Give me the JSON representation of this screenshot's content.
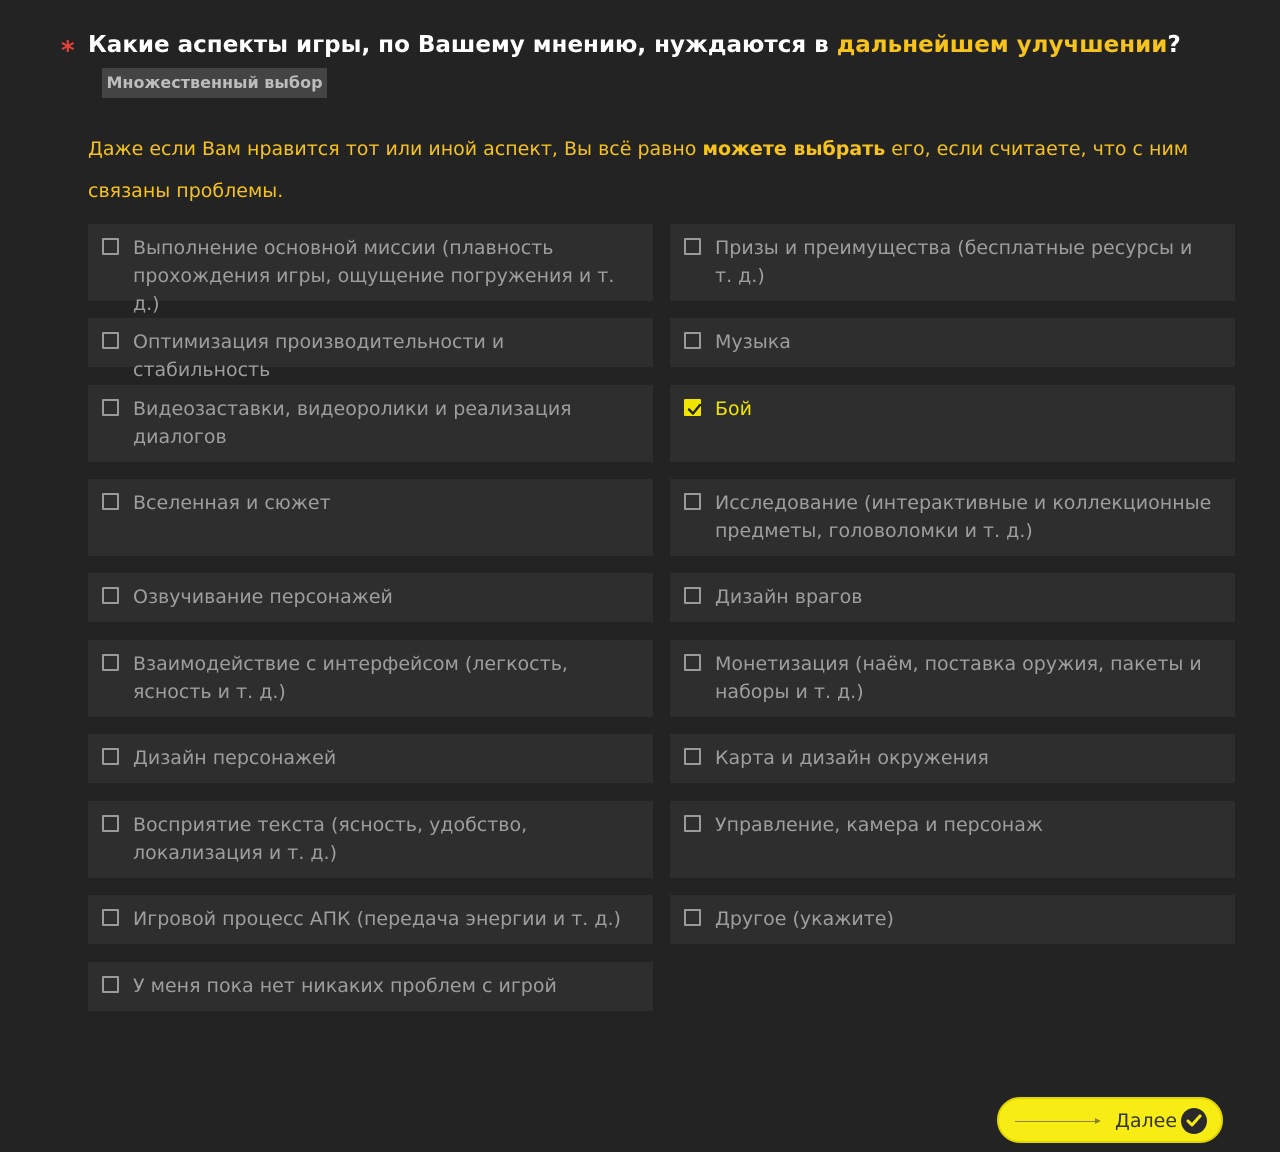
{
  "question": {
    "required_mark": "*",
    "text_before": "Какие аспекты игры, по Вашему мнению, нуждаются в ",
    "highlight": "дальнейшем улучшении",
    "text_after": "?"
  },
  "question_type": "Множественный выбор",
  "hint": {
    "part1": "Даже если Вам нравится тот или иной аспект, Вы всё равно ",
    "bold": "можете выбрать",
    "part2": " его, если считаете, что с ним связаны проблемы."
  },
  "options": [
    {
      "label": "Выполнение основной миссии (плавность прохождения игры, ощущение погружения и т. д.)",
      "checked": false
    },
    {
      "label": "Призы и преимущества (бесплатные ресурсы и т. д.)",
      "checked": false
    },
    {
      "label": "Оптимизация производительности и стабильность",
      "checked": false
    },
    {
      "label": "Музыка",
      "checked": false
    },
    {
      "label": "Видеозаставки, видеоролики и реализация диалогов",
      "checked": false
    },
    {
      "label": "Бой",
      "checked": true
    },
    {
      "label": "Вселенная и сюжет",
      "checked": false
    },
    {
      "label": "Исследование (интерактивные и коллекционные предметы, головоломки и т. д.)",
      "checked": false
    },
    {
      "label": "Озвучивание персонажей",
      "checked": false
    },
    {
      "label": "Дизайн врагов",
      "checked": false
    },
    {
      "label": "Взаимодействие с интерфейсом (легкость, ясность и т. д.)",
      "checked": false
    },
    {
      "label": "Монетизация (наём, поставка оружия, пакеты и наборы и т. д.)",
      "checked": false
    },
    {
      "label": "Дизайн персонажей",
      "checked": false
    },
    {
      "label": "Карта и дизайн окружения",
      "checked": false
    },
    {
      "label": "Восприятие текста (ясность, удобство, локализация и т. д.)",
      "checked": false
    },
    {
      "label": "Управление, камера и персонаж",
      "checked": false
    },
    {
      "label": "Игровой процесс АПК (передача энергии и т. д.)",
      "checked": false
    },
    {
      "label": "Другое (укажите)",
      "checked": false
    },
    {
      "label": "У меня пока нет никаких проблем с игрой",
      "checked": false
    }
  ],
  "next_button": {
    "label": "Далее",
    "icon": "check-circle-icon"
  },
  "colors": {
    "background": "#232323",
    "option_background": "#2e2e2e",
    "accent_yellow": "#f6c21c",
    "checked_yellow": "#f2e600",
    "button_yellow": "#f7ed14",
    "required_red": "#e2433b"
  }
}
